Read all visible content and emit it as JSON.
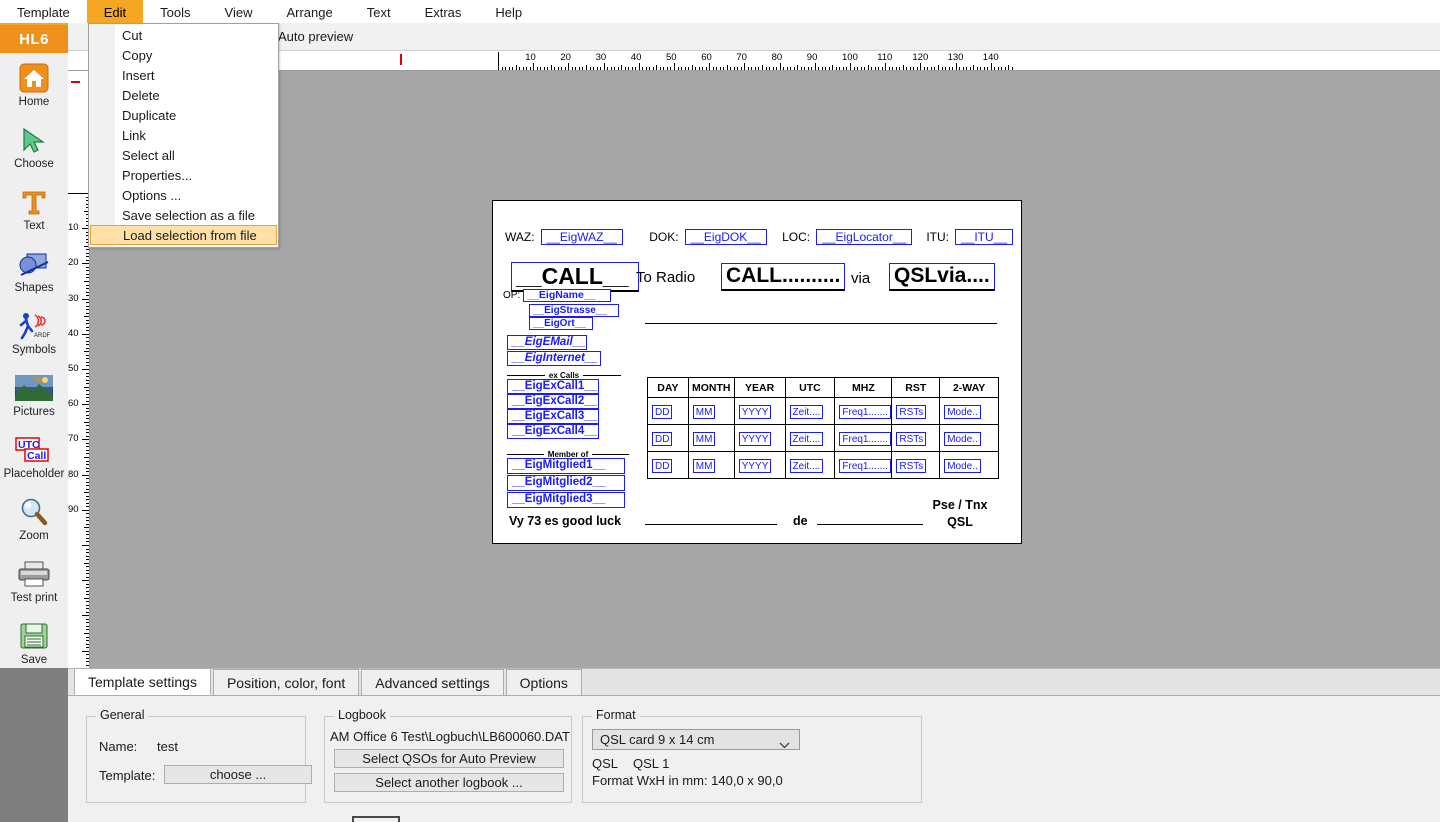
{
  "app": {
    "brand": "HL6"
  },
  "menubar": {
    "items": [
      {
        "label": "Template",
        "active": false
      },
      {
        "label": "Edit",
        "active": true
      },
      {
        "label": "Tools",
        "active": false
      },
      {
        "label": "View",
        "active": false
      },
      {
        "label": "Arrange",
        "active": false
      },
      {
        "label": "Text",
        "active": false
      },
      {
        "label": "Extras",
        "active": false
      },
      {
        "label": "Help",
        "active": false
      }
    ],
    "accent_color": "#f5a623"
  },
  "edit_menu": {
    "items": [
      {
        "label": "Cut",
        "highlighted": false
      },
      {
        "label": "Copy",
        "highlighted": false
      },
      {
        "label": "Insert",
        "highlighted": false
      },
      {
        "label": "Delete",
        "highlighted": false
      },
      {
        "label": "Duplicate",
        "highlighted": false
      },
      {
        "label": "Link",
        "highlighted": false
      },
      {
        "label": "Select all",
        "highlighted": false
      },
      {
        "label": "Properties...",
        "highlighted": false
      },
      {
        "label": "Options ...",
        "highlighted": false
      },
      {
        "label": "Save selection as a file",
        "highlighted": false
      },
      {
        "label": "Load selection from file",
        "highlighted": true
      }
    ],
    "highlight_color": "#ffe0a6"
  },
  "toolbar": {
    "redo_icon": "redo-icon",
    "auto_preview_label": "Auto preview",
    "auto_preview_checked": false
  },
  "sidebar": {
    "items": [
      {
        "label": "Home",
        "icon": "home-icon"
      },
      {
        "label": "Choose",
        "icon": "cursor-arrow-icon"
      },
      {
        "label": "Text",
        "icon": "text-t-icon"
      },
      {
        "label": "Shapes",
        "icon": "shapes-icon"
      },
      {
        "label": "Symbols",
        "icon": "ardf-runner-icon"
      },
      {
        "label": "Pictures",
        "icon": "picture-icon"
      },
      {
        "label": "Placeholder",
        "icon": "utc-call-icon"
      },
      {
        "label": "Zoom",
        "icon": "magnifier-icon"
      },
      {
        "label": "Test print",
        "icon": "printer-icon"
      },
      {
        "label": "Save",
        "icon": "floppy-disk-icon"
      }
    ]
  },
  "rulers": {
    "horizontal_ticks": [
      10,
      20,
      30,
      40,
      50,
      60,
      70,
      80,
      90,
      100,
      110,
      120,
      130,
      140
    ],
    "vertical_ticks": [
      10,
      20,
      30,
      40,
      50,
      60,
      70,
      80,
      90
    ],
    "unit": "mm"
  },
  "card": {
    "top_fields": [
      {
        "label": "WAZ:",
        "value": "__EigWAZ__"
      },
      {
        "label": "DOK:",
        "value": "__EigDOK__"
      },
      {
        "label": "LOC:",
        "value": "__EigLocator__"
      },
      {
        "label": "ITU:",
        "value": "__ITU__"
      }
    ],
    "call_own": "__CALL__",
    "to_radio_label": "To Radio",
    "call_to": "CALL..........",
    "via_label": "via",
    "qsl_via": "QSLvia....",
    "op_label": "OP:",
    "op_name": "__EigName__",
    "address_street": "__EigStrasse__",
    "address_city": "__EigOrt__",
    "email": "__EigEMail__",
    "internet": "__EigInternet__",
    "ex_calls_title": "ex Calls",
    "ex_calls": [
      "__EigExCall1__",
      "__EigExCall2__",
      "__EigExCall3__",
      "__EigExCall4__"
    ],
    "member_of_title": "Member of",
    "members": [
      "__EigMitglied1__",
      "__EigMitglied2__",
      "__EigMitglied3__"
    ],
    "table": {
      "headers": [
        "DAY",
        "MONTH",
        "YEAR",
        "UTC",
        "MHZ",
        "RST",
        "2-WAY"
      ],
      "rows": [
        [
          "DD",
          "MM",
          "YYYY",
          "Zeit....",
          "Freq1.......",
          "RSTs",
          "Mode.."
        ],
        [
          "DD",
          "MM",
          "YYYY",
          "Zeit....",
          "Freq1.......",
          "RSTs",
          "Mode.."
        ],
        [
          "DD",
          "MM",
          "YYYY",
          "Zeit....",
          "Freq1.......",
          "RSTs",
          "Mode.."
        ]
      ]
    },
    "footer_left": "Vy 73 es good luck",
    "footer_de": "de",
    "footer_right_line1": "Pse / Tnx",
    "footer_right_line2": "QSL",
    "field_border_color": "#1a1aff"
  },
  "bottom_tabs": [
    {
      "label": "Template settings",
      "selected": true
    },
    {
      "label": "Position, color, font",
      "selected": false
    },
    {
      "label": "Advanced settings",
      "selected": false
    },
    {
      "label": "Options",
      "selected": false
    }
  ],
  "general_group": {
    "title": "General",
    "name_label": "Name:",
    "name_value": "test",
    "template_label": "Template:",
    "choose_button": "choose ..."
  },
  "logbook_group": {
    "title": "Logbook",
    "path": "AM Office 6 Test\\Logbuch\\LB600060.DAT",
    "select_qsos_button": "Select QSOs for Auto Preview",
    "select_logbook_button": "Select another logbook ..."
  },
  "format_group": {
    "title": "Format",
    "selected_format": "QSL card 9 x 14 cm",
    "caret_icon": "chevron-down-icon",
    "line1_a": "QSL",
    "line1_b": "QSL 1",
    "line2": "Format WxH in mm: 140,0 x 90,0"
  }
}
